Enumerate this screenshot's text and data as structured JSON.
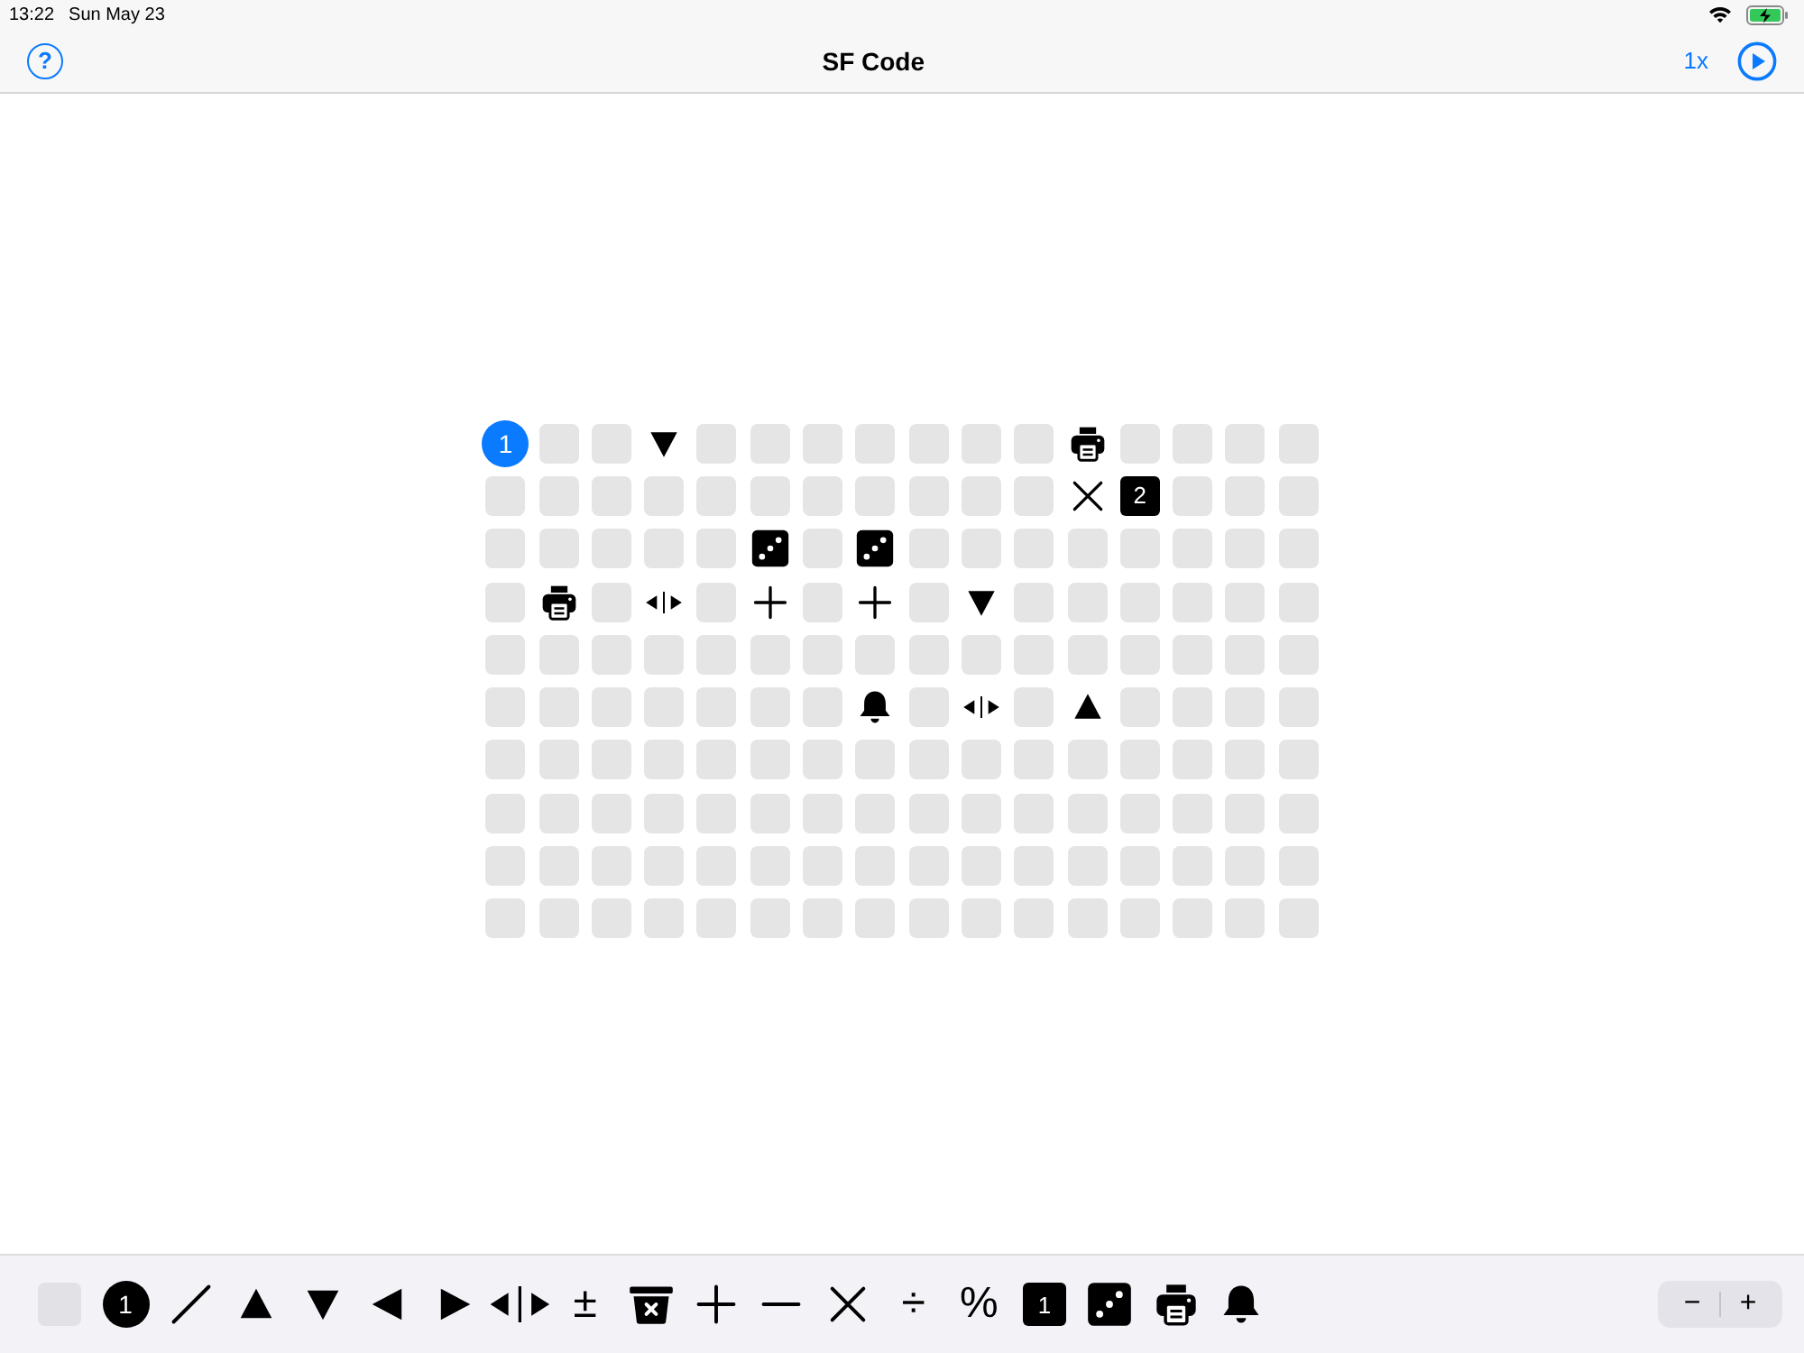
{
  "status_bar": {
    "time": "13:22",
    "date": "Sun May 23"
  },
  "nav_bar": {
    "help": "?",
    "title": "SF Code",
    "speed": "1x"
  },
  "grid": {
    "rows": [
      [
        {
          "kind": "start",
          "label": "1"
        },
        {
          "kind": "empty"
        },
        {
          "kind": "empty"
        },
        {
          "kind": "down"
        },
        {
          "kind": "empty"
        },
        {
          "kind": "empty"
        },
        {
          "kind": "empty"
        },
        {
          "kind": "empty"
        },
        {
          "kind": "empty"
        },
        {
          "kind": "empty"
        },
        {
          "kind": "empty"
        },
        {
          "kind": "printer"
        },
        {
          "kind": "empty"
        },
        {
          "kind": "empty"
        },
        {
          "kind": "empty"
        },
        {
          "kind": "empty"
        }
      ],
      [
        {
          "kind": "empty"
        },
        {
          "kind": "empty"
        },
        {
          "kind": "empty"
        },
        {
          "kind": "empty"
        },
        {
          "kind": "empty"
        },
        {
          "kind": "empty"
        },
        {
          "kind": "empty"
        },
        {
          "kind": "empty"
        },
        {
          "kind": "empty"
        },
        {
          "kind": "empty"
        },
        {
          "kind": "empty"
        },
        {
          "kind": "multiply"
        },
        {
          "kind": "number",
          "label": "2"
        },
        {
          "kind": "empty"
        },
        {
          "kind": "empty"
        },
        {
          "kind": "empty"
        }
      ],
      [
        {
          "kind": "empty"
        },
        {
          "kind": "empty"
        },
        {
          "kind": "empty"
        },
        {
          "kind": "empty"
        },
        {
          "kind": "empty"
        },
        {
          "kind": "dice"
        },
        {
          "kind": "empty"
        },
        {
          "kind": "dice"
        },
        {
          "kind": "empty"
        },
        {
          "kind": "empty"
        },
        {
          "kind": "empty"
        },
        {
          "kind": "empty"
        },
        {
          "kind": "empty"
        },
        {
          "kind": "empty"
        },
        {
          "kind": "empty"
        },
        {
          "kind": "empty"
        }
      ],
      [
        {
          "kind": "empty"
        },
        {
          "kind": "printer"
        },
        {
          "kind": "empty"
        },
        {
          "kind": "mirror"
        },
        {
          "kind": "empty"
        },
        {
          "kind": "plus"
        },
        {
          "kind": "empty"
        },
        {
          "kind": "plus"
        },
        {
          "kind": "empty"
        },
        {
          "kind": "down"
        },
        {
          "kind": "empty"
        },
        {
          "kind": "empty"
        },
        {
          "kind": "empty"
        },
        {
          "kind": "empty"
        },
        {
          "kind": "empty"
        },
        {
          "kind": "empty"
        }
      ],
      [
        {
          "kind": "empty"
        },
        {
          "kind": "empty"
        },
        {
          "kind": "empty"
        },
        {
          "kind": "empty"
        },
        {
          "kind": "empty"
        },
        {
          "kind": "empty"
        },
        {
          "kind": "empty"
        },
        {
          "kind": "empty"
        },
        {
          "kind": "empty"
        },
        {
          "kind": "empty"
        },
        {
          "kind": "empty"
        },
        {
          "kind": "empty"
        },
        {
          "kind": "empty"
        },
        {
          "kind": "empty"
        },
        {
          "kind": "empty"
        },
        {
          "kind": "empty"
        }
      ],
      [
        {
          "kind": "empty"
        },
        {
          "kind": "empty"
        },
        {
          "kind": "empty"
        },
        {
          "kind": "empty"
        },
        {
          "kind": "empty"
        },
        {
          "kind": "empty"
        },
        {
          "kind": "empty"
        },
        {
          "kind": "bell"
        },
        {
          "kind": "empty"
        },
        {
          "kind": "mirror"
        },
        {
          "kind": "empty"
        },
        {
          "kind": "up"
        },
        {
          "kind": "empty"
        },
        {
          "kind": "empty"
        },
        {
          "kind": "empty"
        },
        {
          "kind": "empty"
        }
      ],
      [
        {
          "kind": "empty"
        },
        {
          "kind": "empty"
        },
        {
          "kind": "empty"
        },
        {
          "kind": "empty"
        },
        {
          "kind": "empty"
        },
        {
          "kind": "empty"
        },
        {
          "kind": "empty"
        },
        {
          "kind": "empty"
        },
        {
          "kind": "empty"
        },
        {
          "kind": "empty"
        },
        {
          "kind": "empty"
        },
        {
          "kind": "empty"
        },
        {
          "kind": "empty"
        },
        {
          "kind": "empty"
        },
        {
          "kind": "empty"
        },
        {
          "kind": "empty"
        }
      ],
      [
        {
          "kind": "empty"
        },
        {
          "kind": "empty"
        },
        {
          "kind": "empty"
        },
        {
          "kind": "empty"
        },
        {
          "kind": "empty"
        },
        {
          "kind": "empty"
        },
        {
          "kind": "empty"
        },
        {
          "kind": "empty"
        },
        {
          "kind": "empty"
        },
        {
          "kind": "empty"
        },
        {
          "kind": "empty"
        },
        {
          "kind": "empty"
        },
        {
          "kind": "empty"
        },
        {
          "kind": "empty"
        },
        {
          "kind": "empty"
        },
        {
          "kind": "empty"
        }
      ],
      [
        {
          "kind": "empty"
        },
        {
          "kind": "empty"
        },
        {
          "kind": "empty"
        },
        {
          "kind": "empty"
        },
        {
          "kind": "empty"
        },
        {
          "kind": "empty"
        },
        {
          "kind": "empty"
        },
        {
          "kind": "empty"
        },
        {
          "kind": "empty"
        },
        {
          "kind": "empty"
        },
        {
          "kind": "empty"
        },
        {
          "kind": "empty"
        },
        {
          "kind": "empty"
        },
        {
          "kind": "empty"
        },
        {
          "kind": "empty"
        },
        {
          "kind": "empty"
        }
      ],
      [
        {
          "kind": "empty"
        },
        {
          "kind": "empty"
        },
        {
          "kind": "empty"
        },
        {
          "kind": "empty"
        },
        {
          "kind": "empty"
        },
        {
          "kind": "empty"
        },
        {
          "kind": "empty"
        },
        {
          "kind": "empty"
        },
        {
          "kind": "empty"
        },
        {
          "kind": "empty"
        },
        {
          "kind": "empty"
        },
        {
          "kind": "empty"
        },
        {
          "kind": "empty"
        },
        {
          "kind": "empty"
        },
        {
          "kind": "empty"
        },
        {
          "kind": "empty"
        }
      ]
    ]
  },
  "palette": [
    {
      "kind": "empty"
    },
    {
      "kind": "start",
      "label": "1"
    },
    {
      "kind": "slash"
    },
    {
      "kind": "up"
    },
    {
      "kind": "down"
    },
    {
      "kind": "left"
    },
    {
      "kind": "right"
    },
    {
      "kind": "mirror"
    },
    {
      "kind": "symbol",
      "label": "±"
    },
    {
      "kind": "bin"
    },
    {
      "kind": "plus"
    },
    {
      "kind": "minus"
    },
    {
      "kind": "multiply"
    },
    {
      "kind": "symbol",
      "label": "÷"
    },
    {
      "kind": "symbol",
      "label": "%"
    },
    {
      "kind": "number",
      "label": "1"
    },
    {
      "kind": "dice"
    },
    {
      "kind": "printer"
    },
    {
      "kind": "bell"
    }
  ],
  "zoom_stepper": {
    "decrease": "−",
    "increase": "+"
  }
}
